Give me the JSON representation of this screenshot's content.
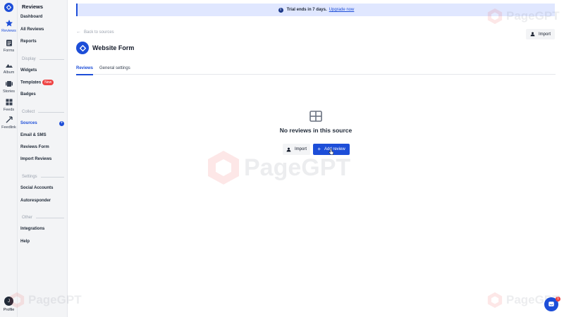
{
  "rail": {
    "items": [
      {
        "label": "Reviews",
        "icon": "star-icon"
      },
      {
        "label": "Forms",
        "icon": "clipboard-icon"
      },
      {
        "label": "Album",
        "icon": "image-icon"
      },
      {
        "label": "Stories",
        "icon": "stories-icon"
      },
      {
        "label": "Feeds",
        "icon": "grid-icon"
      },
      {
        "label": "Feedlink",
        "icon": "feedlink-icon"
      }
    ],
    "avatar_initial": "J",
    "profile_label": "Profile"
  },
  "sidebar": {
    "title": "Reviews",
    "items": {
      "dashboard": "Dashboard",
      "all_reviews": "All Reviews",
      "reports": "Reports",
      "widgets": "Widgets",
      "templates": "Templates",
      "templates_badge": "New",
      "badges": "Badges",
      "sources": "Sources",
      "sources_add": "+",
      "email_sms": "Email & SMS",
      "reviews_form": "Reviews Form",
      "import_reviews": "Import Reviews",
      "social_accounts": "Social Accounts",
      "autoresponder": "Autoresponder",
      "integrations": "Integrations",
      "help": "Help"
    },
    "sections": {
      "display": "Display",
      "collect": "Collect",
      "settings": "Settings",
      "other": "Other"
    }
  },
  "trial": {
    "icon": "info-icon",
    "message": "Trial ends in 7 days.",
    "link": "Upgrade now"
  },
  "header": {
    "back": "Back to sources",
    "import": "Import",
    "title": "Website Form"
  },
  "tabs": [
    {
      "label": "Reviews",
      "active": true
    },
    {
      "label": "General settings",
      "active": false
    }
  ],
  "empty_state": {
    "title": "No reviews in this source",
    "import": "Import",
    "add": "Add review"
  },
  "chat": {
    "badge": "1"
  },
  "watermark": "PageGPT",
  "colors": {
    "accent": "#1d4ed8",
    "trial_bg": "#e0e7ff",
    "badge": "#ef4444",
    "sidebar_bg": "#f3f4f6"
  }
}
